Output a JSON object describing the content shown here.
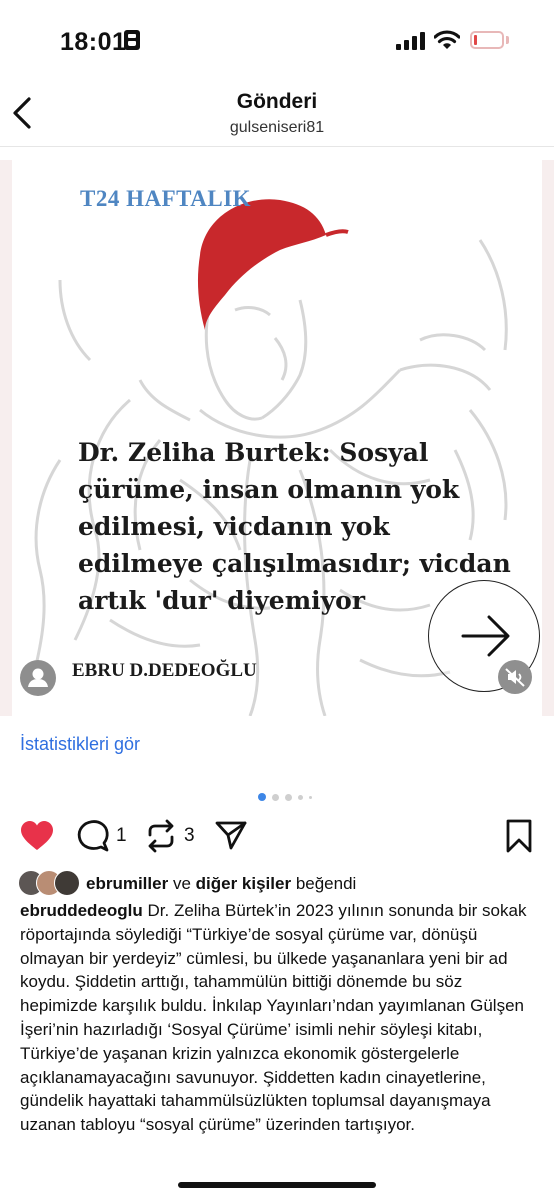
{
  "status_bar": {
    "time": "18:01"
  },
  "header": {
    "title": "Gönderi",
    "username": "gulseniseri81"
  },
  "post_image": {
    "brand": "T24 HAFTALIK",
    "headline": "Dr. Zeliha Burtek: Sosyal çürüme, insan olmanın yok edilmesi, vicdanın yok edilmeye çalışılmasıdır; vicdan artık 'dur' diyemiyor",
    "author": "EBRU D.DEDEOĞLU"
  },
  "insights_link": "İstatistikleri gör",
  "carousel": {
    "total_dots": 5,
    "active_index": 0
  },
  "actions": {
    "comment_count": "1",
    "repost_count": "3"
  },
  "likes": {
    "first_user": "ebrumiller",
    "connector": "ve",
    "others": "diğer kişiler",
    "suffix": "beğendi"
  },
  "caption": {
    "username": "ebruddedeoglu",
    "text": "Dr. Zeliha Bürtek’in 2023 yılının sonunda bir sokak röportajında söylediği “Türkiye’de sosyal çürüme var, dönüşü olmayan bir yerdeyiz” cümlesi, bu ülkede yaşananlara yeni bir ad koydu. Şiddetin arttığı, tahammülün bittiği dönemde bu söz hepimizde karşılık buldu. İnkılap Yayınları’ndan yayımlanan Gülşen İşeri’nin hazırladığı ‘Sosyal Çürüme’ isimli nehir söyleşi kitabı, Türkiye’de yaşanan krizin yalnızca ekonomik göstergelerle açıklanamayacağını savunuyor. Şiddetten kadın cinayetlerine, gündelik hayattaki tahammülsüzlükten toplumsal dayanışmaya uzanan tabloyu “sosyal çürüme” üzerinden tartışıyor."
  },
  "colors": {
    "heart": "#e8324a",
    "link": "#2f6fe0",
    "brand": "#4f86c2",
    "cap_red": "#c8282c",
    "active_dot": "#3d86e6"
  }
}
